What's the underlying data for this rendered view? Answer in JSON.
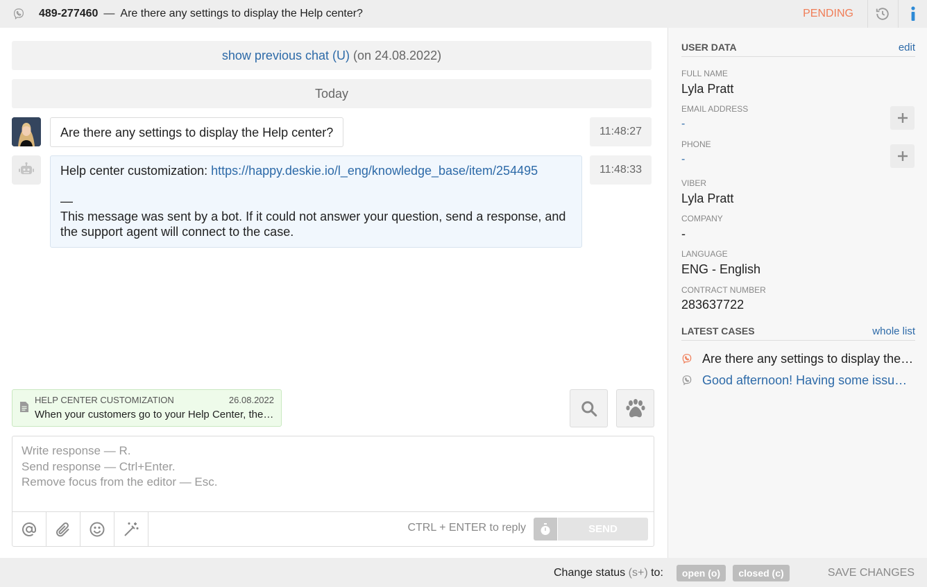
{
  "header": {
    "case_id": "489-277460",
    "separator": "—",
    "subject": "Are there any settings to display the Help center?",
    "status": "PENDING",
    "status_color": "#f07d57",
    "icons": [
      "viber-icon",
      "history-icon",
      "info-icon"
    ]
  },
  "chat": {
    "previous": {
      "link": "show previous chat (U)",
      "date_text": "(on 24.08.2022)"
    },
    "day_label": "Today",
    "messages": [
      {
        "sender": "user",
        "text": "Are there any settings to display the Help center?",
        "time": "11:48:27"
      },
      {
        "sender": "bot",
        "prefix": "Help center customization: ",
        "link": "https://happy.deskie.io/l_eng/knowledge_base/item/254495",
        "dash": "—",
        "note": "This message was sent by a bot. If it could not answer your question, send a response, and the support agent will connect to the case.",
        "time": "11:48:33"
      }
    ]
  },
  "suggestion": {
    "title": "HELP CENTER CUSTOMIZATION",
    "date": "26.08.2022",
    "text": "When your customers go to your Help Center, the information you have added there will be displayed."
  },
  "editor": {
    "placeholder_lines": [
      "Write response — R.",
      "Send response — Ctrl+Enter.",
      "Remove focus from the editor — Esc."
    ],
    "hint": "CTRL + ENTER to reply",
    "send_label": "SEND"
  },
  "user_data": {
    "heading": "USER DATA",
    "edit_label": "edit",
    "fields": [
      {
        "label": "FULL NAME",
        "value": "Lyla Pratt"
      },
      {
        "label": "EMAIL ADDRESS",
        "value": "-"
      },
      {
        "label": "PHONE",
        "value": "-"
      },
      {
        "label": "VIBER",
        "value": "Lyla Pratt"
      },
      {
        "label": "COMPANY",
        "value": "-"
      },
      {
        "label": "LANGUAGE",
        "value": "ENG - English"
      },
      {
        "label": "CONTRACT NUMBER",
        "value": "283637722"
      }
    ]
  },
  "latest_cases": {
    "heading": "LATEST CASES",
    "link_label": "whole list",
    "items": [
      {
        "text": "Are there any settings to display the Help center?",
        "color": "#222222",
        "icon_color": "#f07d57"
      },
      {
        "text": "Good afternoon! Having some issue that needs your help",
        "color": "#2d6aa8",
        "icon_color": "#999999"
      }
    ]
  },
  "footer": {
    "change_label": "Change status",
    "shortcut": "(s+)",
    "to_label": "to:",
    "open_label": "open (o)",
    "closed_label": "closed (c)",
    "save_label": "SAVE CHANGES"
  }
}
